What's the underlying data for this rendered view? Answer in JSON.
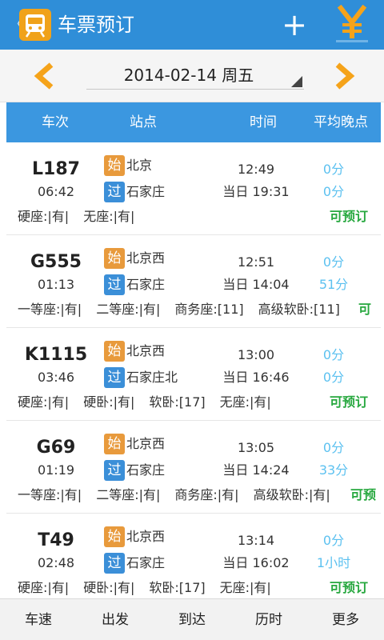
{
  "appbar": {
    "back_glyph": "〈",
    "logo_icon": "train-icon",
    "title": "车票预订",
    "add_glyph": "+",
    "yen_icon": "yen-icon",
    "accent": "#2f8ed8"
  },
  "datebar": {
    "date_text": "2014-02-14 周五",
    "arrow_color": "#f5a31a"
  },
  "columns": {
    "train": "车次",
    "station": "站点",
    "time": "时间",
    "delay": "平均晚点"
  },
  "badges": {
    "start": "始",
    "pass": "过"
  },
  "trains": [
    {
      "train_no": "L187",
      "duration": "06:42",
      "from_station": "北京",
      "to_station": "石家庄",
      "depart": "12:49",
      "arrive": "当日 19:31",
      "depart_delay": "0分",
      "arrive_delay": "0分",
      "seats": [
        "硬座:|有|",
        "无座:|有|"
      ],
      "status": "可预订"
    },
    {
      "train_no": "G555",
      "duration": "01:13",
      "from_station": "北京西",
      "to_station": "石家庄",
      "depart": "12:51",
      "arrive": "当日 14:04",
      "depart_delay": "0分",
      "arrive_delay": "51分",
      "seats": [
        "一等座:|有|",
        "二等座:|有|",
        "商务座:[11]",
        "高级软卧:[11]"
      ],
      "status": "可"
    },
    {
      "train_no": "K1115",
      "duration": "03:46",
      "from_station": "北京西",
      "to_station": "石家庄北",
      "depart": "13:00",
      "arrive": "当日 16:46",
      "depart_delay": "0分",
      "arrive_delay": "0分",
      "seats": [
        "硬座:|有|",
        "硬卧:|有|",
        "软卧:[17]",
        "无座:|有|"
      ],
      "status": "可预订"
    },
    {
      "train_no": "G69",
      "duration": "01:19",
      "from_station": "北京西",
      "to_station": "石家庄",
      "depart": "13:05",
      "arrive": "当日 14:24",
      "depart_delay": "0分",
      "arrive_delay": "33分",
      "seats": [
        "一等座:|有|",
        "二等座:|有|",
        "商务座:|有|",
        "高级软卧:|有|"
      ],
      "status": "可预"
    },
    {
      "train_no": "T49",
      "duration": "02:48",
      "from_station": "北京西",
      "to_station": "石家庄",
      "depart": "13:14",
      "arrive": "当日 16:02",
      "depart_delay": "0分",
      "arrive_delay": "1小时",
      "seats": [
        "硬座:|有|",
        "硬卧:|有|",
        "软卧:[17]",
        "无座:|有|"
      ],
      "status": "可预订"
    }
  ],
  "tabs": [
    "车速",
    "出发",
    "到达",
    "历时",
    "更多"
  ]
}
